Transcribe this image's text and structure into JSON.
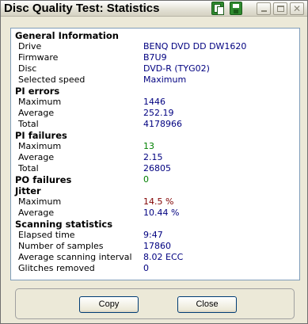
{
  "window": {
    "title": "Disc Quality Test: Statistics",
    "toolbar": {
      "copy_icon": "copy-icon",
      "save_icon": "save-icon"
    }
  },
  "sections": {
    "general": {
      "title": "General Information",
      "drive_label": "Drive",
      "drive_value": "BENQ     DVD DD DW1620",
      "firmware_label": "Firmware",
      "firmware_value": "B7U9",
      "disc_label": "Disc",
      "disc_value": "DVD-R (TYG02)",
      "speed_label": "Selected speed",
      "speed_value": "Maximum"
    },
    "pi_errors": {
      "title": "PI errors",
      "max_label": "Maximum",
      "max_value": "1446",
      "avg_label": "Average",
      "avg_value": "252.19",
      "total_label": "Total",
      "total_value": "4178966"
    },
    "pi_failures": {
      "title": "PI failures",
      "max_label": "Maximum",
      "max_value": "13",
      "avg_label": "Average",
      "avg_value": "2.15",
      "total_label": "Total",
      "total_value": "26805"
    },
    "po_failures": {
      "title": "PO failures",
      "value": "0"
    },
    "jitter": {
      "title": "Jitter",
      "max_label": "Maximum",
      "max_value": "14.5 %",
      "avg_label": "Average",
      "avg_value": "10.44 %"
    },
    "scanning": {
      "title": "Scanning statistics",
      "elapsed_label": "Elapsed time",
      "elapsed_value": "9:47",
      "samples_label": "Number of samples",
      "samples_value": "17860",
      "interval_label": "Average scanning interval",
      "interval_value": "8.02 ECC",
      "glitches_label": "Glitches removed",
      "glitches_value": "0"
    }
  },
  "buttons": {
    "copy_label": "Copy",
    "close_label": "Close"
  },
  "colors": {
    "value": "#000080",
    "good": "#008000",
    "warn": "#800000"
  }
}
